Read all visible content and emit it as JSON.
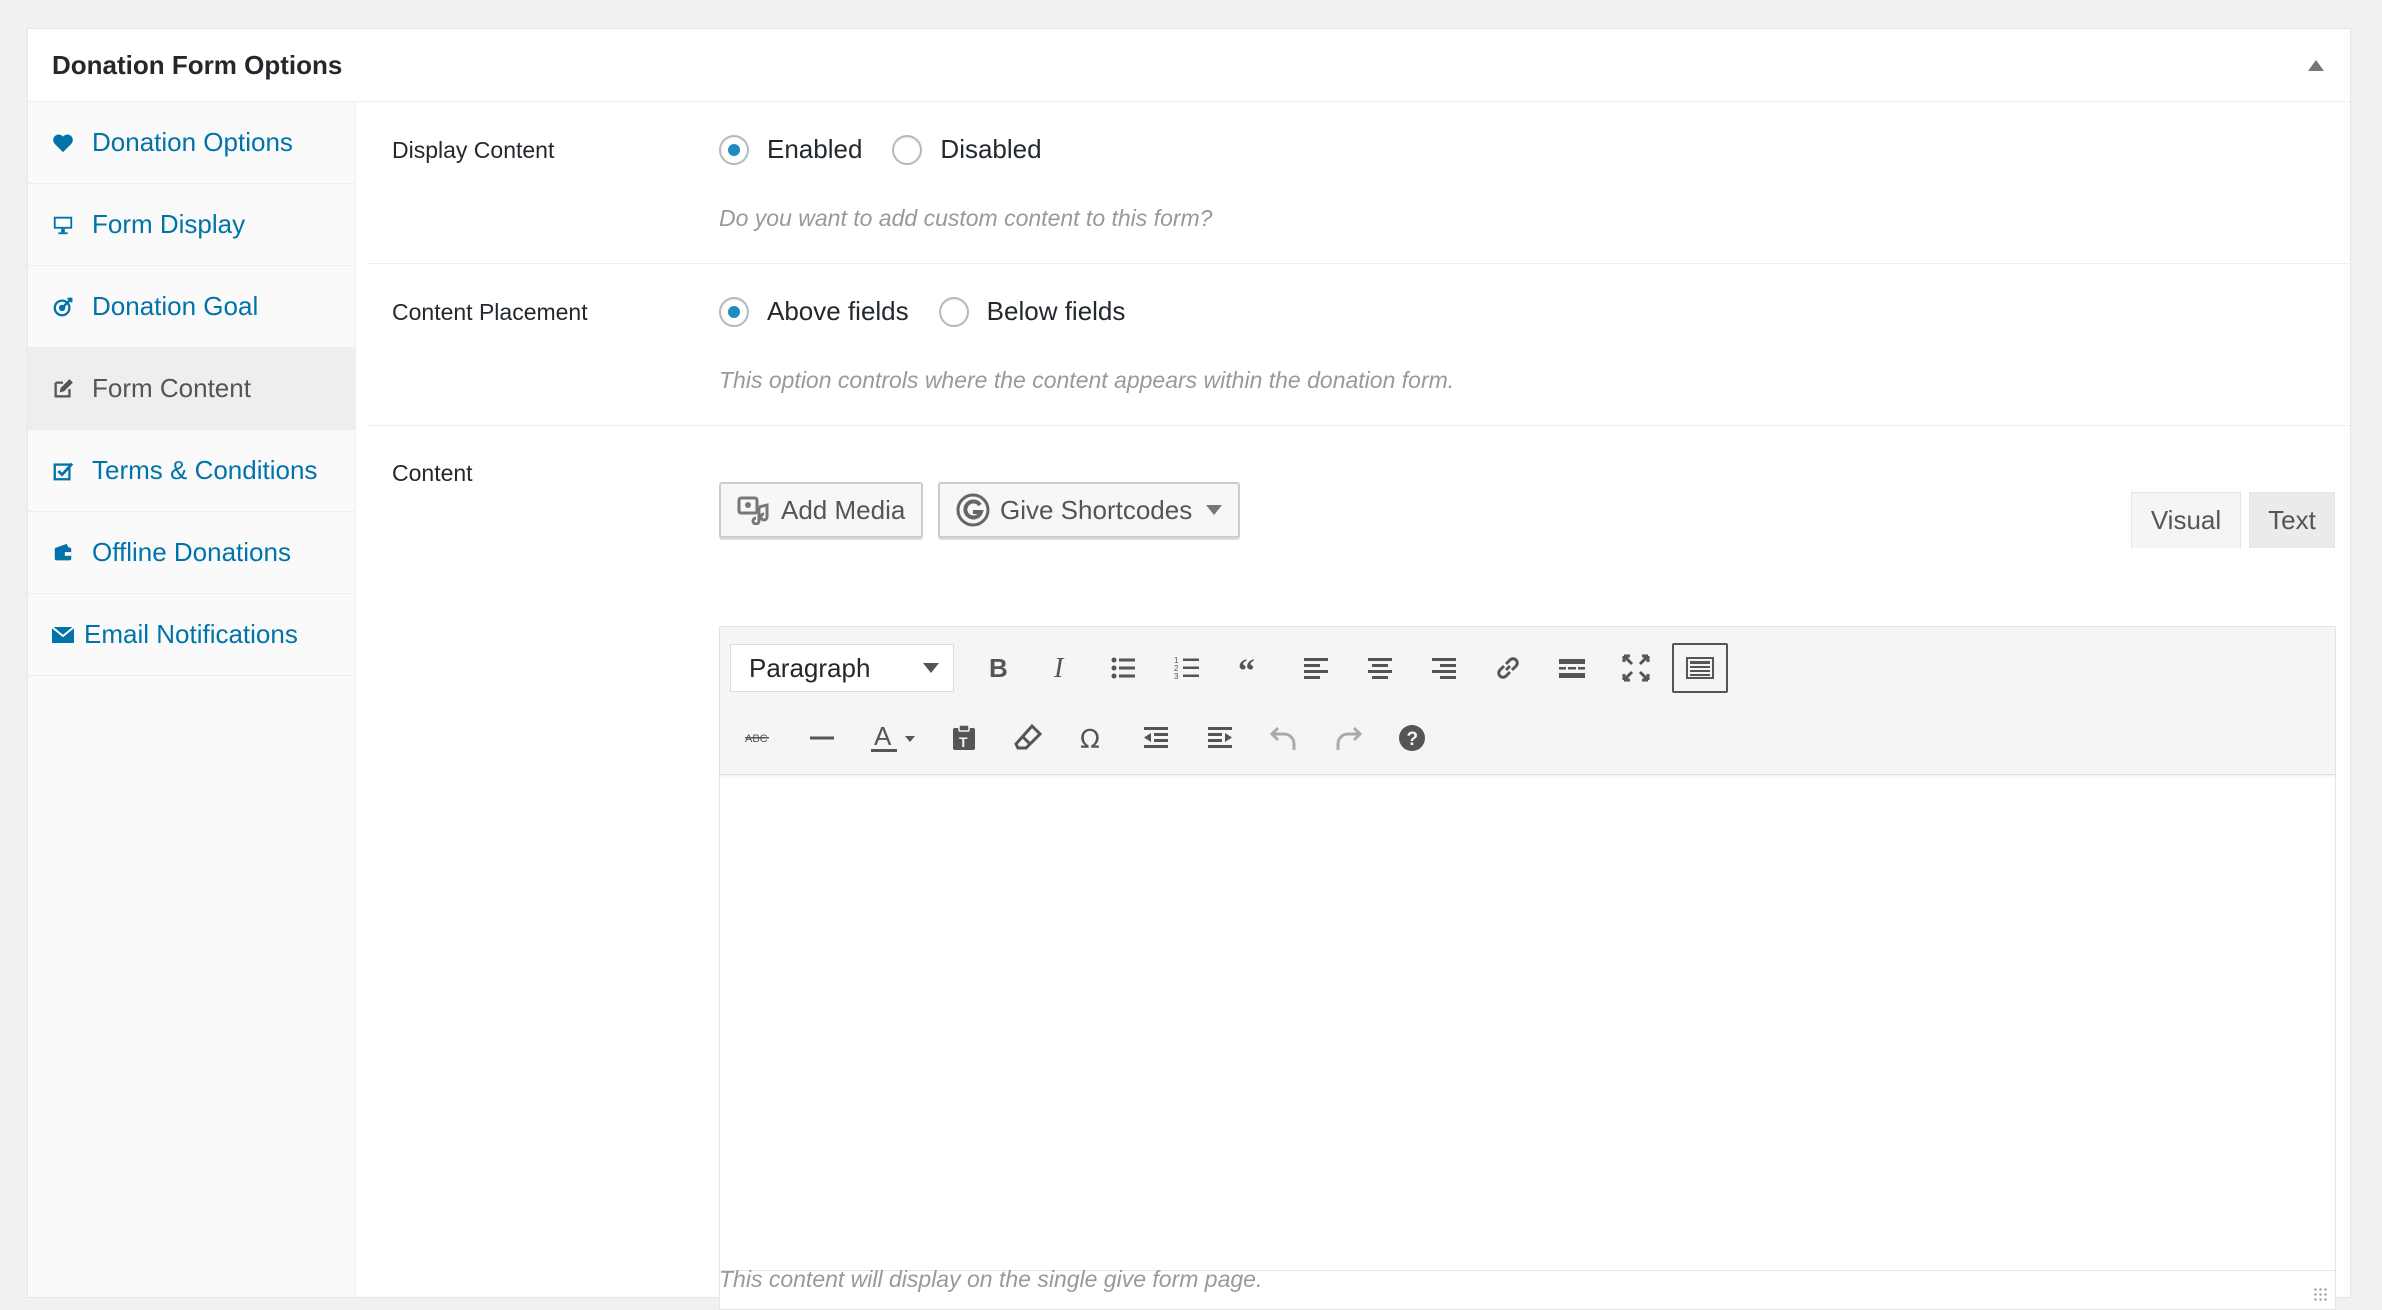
{
  "panel": {
    "title": "Donation Form Options"
  },
  "sidebar": {
    "items": [
      {
        "label": "Donation Options",
        "icon": "heart-icon"
      },
      {
        "label": "Form Display",
        "icon": "monitor-icon"
      },
      {
        "label": "Donation Goal",
        "icon": "target-icon"
      },
      {
        "label": "Form Content",
        "icon": "edit-icon",
        "active": true
      },
      {
        "label": "Terms & Conditions",
        "icon": "checkbox-icon"
      },
      {
        "label": "Offline Donations",
        "icon": "wallet-icon"
      },
      {
        "label": "Email Notifications",
        "icon": "email-icon"
      }
    ]
  },
  "display_content": {
    "label": "Display Content",
    "options": [
      "Enabled",
      "Disabled"
    ],
    "selected": "Enabled",
    "description": "Do you want to add custom content to this form?"
  },
  "content_placement": {
    "label": "Content Placement",
    "options": [
      "Above fields",
      "Below fields"
    ],
    "selected": "Above fields",
    "description": "This option controls where the content appears within the donation form."
  },
  "content": {
    "label": "Content",
    "add_media": "Add Media",
    "shortcodes": "Give Shortcodes",
    "tab_visual": "Visual",
    "tab_text": "Text",
    "format_select": "Paragraph",
    "description": "This content will display on the single give form page."
  },
  "colors": {
    "link": "#0073aa",
    "accent": "#1e8cbe"
  }
}
